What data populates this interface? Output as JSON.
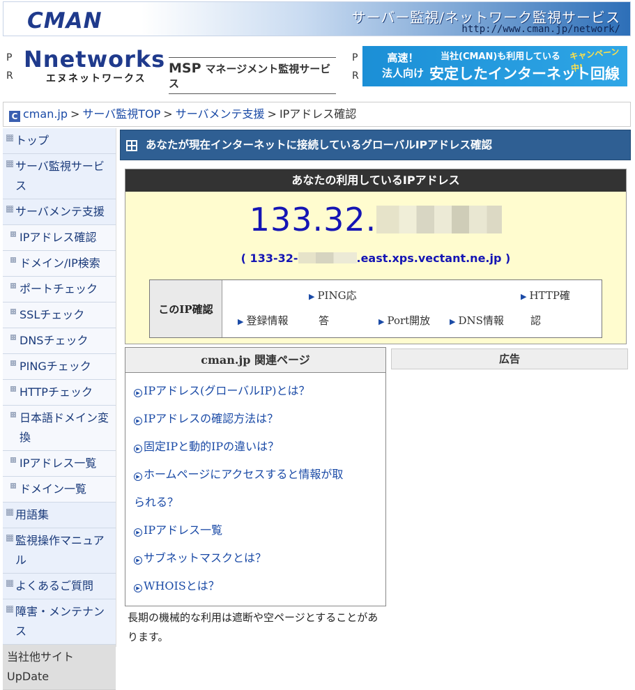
{
  "header": {
    "logo": "CMAN",
    "title": "サーバー監視/ネットワーク監視サービス",
    "url": "http://www.cman.jp/network/"
  },
  "ads": {
    "pr_left": [
      "P",
      "R"
    ],
    "pr_right": [
      "P",
      "R"
    ],
    "nnetworks": {
      "brand": "Nnetworks",
      "sub": "エヌネットワークス",
      "msp": "MSP",
      "msp_text": "マネージメント監視サービス"
    },
    "banner": {
      "line1a": "高速！",
      "line1b": "法人向け",
      "tag": "当社(CMAN)も利用している",
      "campaign": "キャンペーン中!",
      "main": "安定したインターネット回線"
    }
  },
  "breadcrumb": {
    "icon": "C",
    "items": [
      "cman.jp",
      "サーバ監視TOP",
      "サーバメンテ支援"
    ],
    "sep": ">",
    "current": "IPアドレス確認"
  },
  "sidebar": {
    "items": [
      {
        "label": "トップ",
        "sub": false
      },
      {
        "label": "サーバ監視サービス",
        "sub": false
      },
      {
        "label": "サーバメンテ支援",
        "sub": false
      },
      {
        "label": "IPアドレス確認",
        "sub": true
      },
      {
        "label": "ドメイン/IP検索",
        "sub": true
      },
      {
        "label": "ポートチェック",
        "sub": true
      },
      {
        "label": "SSLチェック",
        "sub": true
      },
      {
        "label": "DNSチェック",
        "sub": true
      },
      {
        "label": "PINGチェック",
        "sub": true
      },
      {
        "label": "HTTPチェック",
        "sub": true
      },
      {
        "label": "日本語ドメイン変換",
        "sub": true
      },
      {
        "label": "IPアドレス一覧",
        "sub": true
      },
      {
        "label": "ドメイン一覧",
        "sub": true
      },
      {
        "label": "用語集",
        "sub": false
      },
      {
        "label": "監視操作マニュアル",
        "sub": false
      },
      {
        "label": "よくあるご質問",
        "sub": false
      },
      {
        "label": "障害・メンテナンス",
        "sub": false
      }
    ],
    "update": "当社他サイトUpDate"
  },
  "main": {
    "title": "あなたが現在インターネットに接続しているグローバルIPアドレス確認",
    "ip_head": "あなたの利用しているIPアドレス",
    "ip_prefix": "133.32.",
    "host_open": "( 133-32-",
    "host_suffix": ".east.xps.vectant.ne.jp )",
    "check_label": "このIP確認",
    "check_links": {
      "whois": "登録情報",
      "ping_a": "PING応",
      "ping_b": "答",
      "port": "Port開放",
      "dns": "DNS情報",
      "http_a": "HTTP確",
      "http_b": "認"
    }
  },
  "related": {
    "head": "cman.jp 関連ページ",
    "links": [
      "IPアドレス(グローバルIP)とは？",
      "IPアドレスの確認方法は？",
      "固定IPと動的IPの違いは？",
      "ホームページにアクセスすると情報が取",
      "られる？",
      "IPアドレス一覧",
      "サブネットマスクとは？",
      "WHOISとは？"
    ]
  },
  "ad_head": "広告",
  "note": "長期の機械的な利用は遮断や空ページとすることがあります。"
}
